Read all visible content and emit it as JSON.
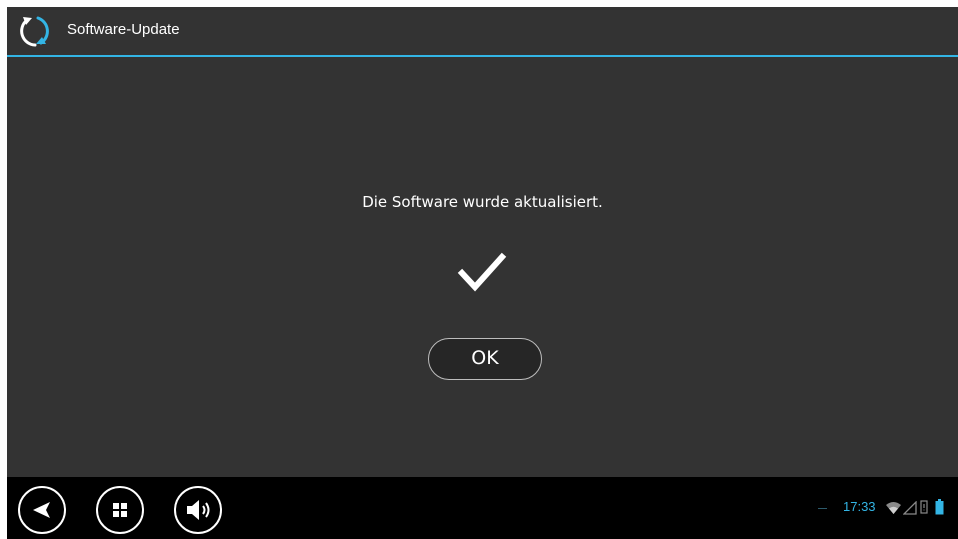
{
  "titlebar": {
    "title": "Software-Update",
    "accent_color": "#33b5e5",
    "icon": "update-sync-icon"
  },
  "main": {
    "message": "Die Software wurde aktualisiert.",
    "status_icon": "check-icon",
    "ok_label": "OK"
  },
  "navbar": {
    "buttons": [
      "back-icon",
      "apps-grid-icon",
      "volume-icon"
    ]
  },
  "status_bar": {
    "time": "17:33",
    "icons": [
      "wifi-icon",
      "signal-icon",
      "no-sim-icon",
      "battery-icon"
    ]
  }
}
